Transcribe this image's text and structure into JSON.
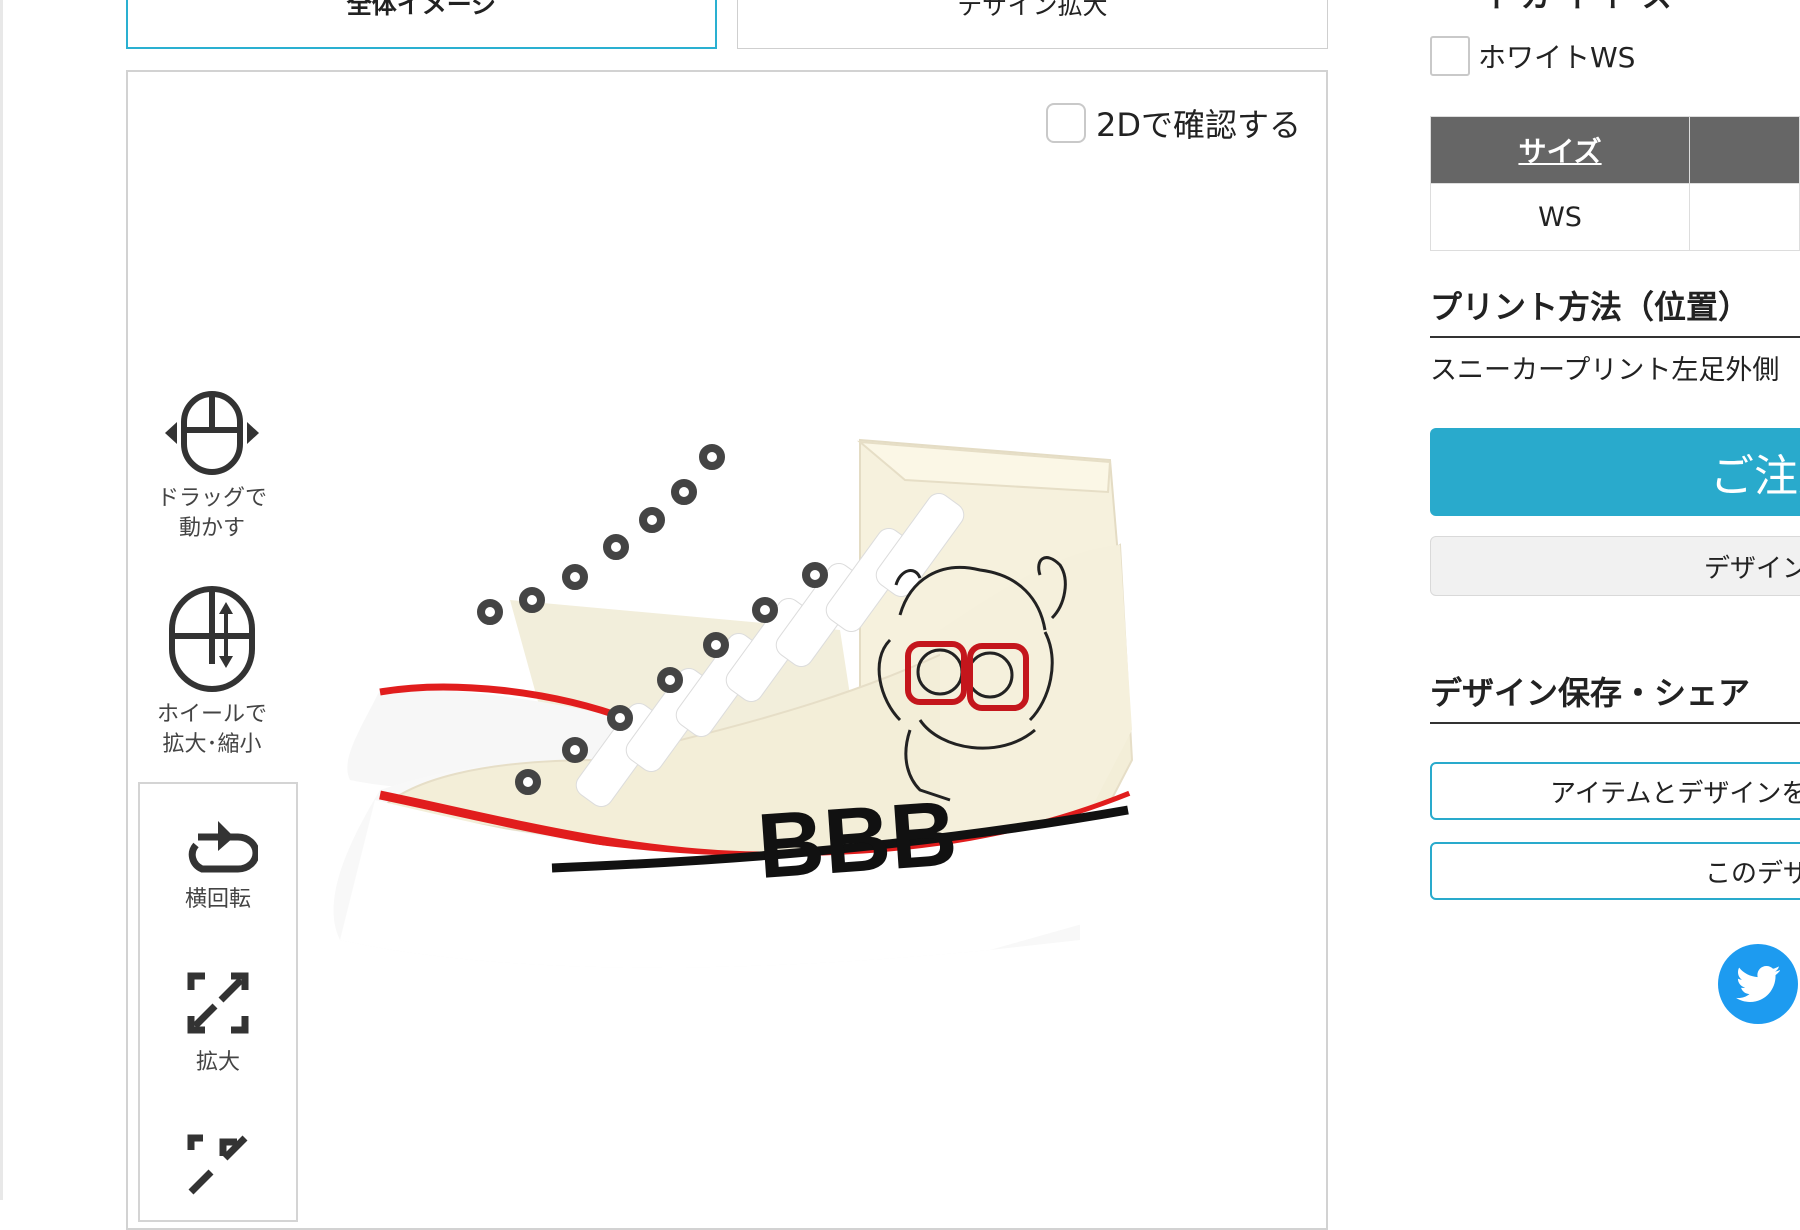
{
  "tabs": [
    {
      "label": "全体イメージ",
      "active": true
    },
    {
      "label": "デザイン拡大",
      "active": false
    }
  ],
  "viewer": {
    "check_2d_label": "2Dで確認する",
    "hints": [
      {
        "line1": "ドラッグで",
        "line2": "動かす",
        "icon": "mouse-drag-icon"
      },
      {
        "line1": "ホイールで",
        "line2": "拡大･縮小",
        "icon": "mouse-wheel-icon"
      }
    ],
    "tools": [
      {
        "label": "横回転",
        "icon": "rotate-icon"
      },
      {
        "label": "拡大",
        "icon": "expand-icon"
      },
      {
        "label": "",
        "icon": "shrink-icon"
      }
    ],
    "design_text": "BBB"
  },
  "right": {
    "heading_partial": "イ カ イ ト ス ー",
    "color_option": "ホワイトWS",
    "size_table": {
      "header": "サイズ",
      "value": "WS"
    },
    "print_title": "プリント方法（位置）",
    "print_method": "スニーカープリント左足外側",
    "order_button": "ご注文",
    "design_button": "デザイン",
    "save_share_title": "デザイン保存・シェア",
    "save_item_button": "アイテムとデザインを",
    "this_design_button": "このデザ",
    "twitter": "twitter-icon"
  },
  "colors": {
    "accent": "#29aacc",
    "table_header": "#666666",
    "sole_stripe": "#e11d1d",
    "twitter": "#1d9bf0"
  }
}
